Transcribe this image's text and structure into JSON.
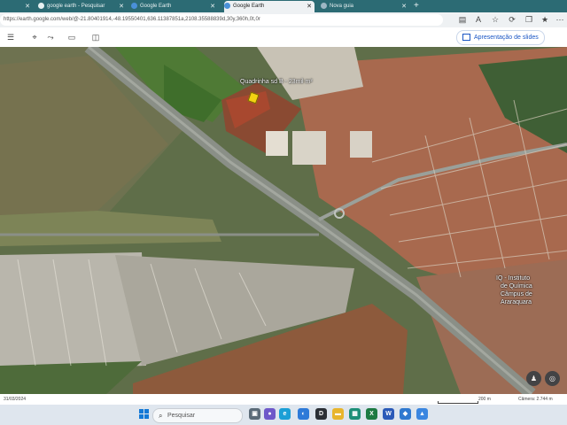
{
  "browser": {
    "tabs": [
      {
        "label": "google earth - Pesquisar",
        "active": false
      },
      {
        "label": "Google Earth",
        "active": false
      },
      {
        "label": "Google Earth",
        "active": true
      },
      {
        "label": "Nova guia",
        "active": false
      }
    ],
    "url": "earth.google.com/web/@-21.80401914,-48.19550401,636.11387851a,2108.35588839d,30y,360h,0t,0r",
    "url_prefix": "https://"
  },
  "earth": {
    "present_label": "Apresentação de slides",
    "map_labels": [
      {
        "text": "Quadrinha sd B - 23mil m²"
      },
      {
        "text": "IQ - Instituto"
      },
      {
        "text": "de Química"
      },
      {
        "text": "Câmpus de"
      },
      {
        "text": "Araraquara"
      }
    ],
    "status": {
      "date": "31/03/2024",
      "scale": "200 m",
      "camera": "Câmera: 2.744 m"
    }
  },
  "taskbar": {
    "search_placeholder": "Pesquisar"
  },
  "colors": {
    "tabbar": "#2c6b74",
    "accent": "#1a56c4",
    "pin": "#f3d312"
  }
}
